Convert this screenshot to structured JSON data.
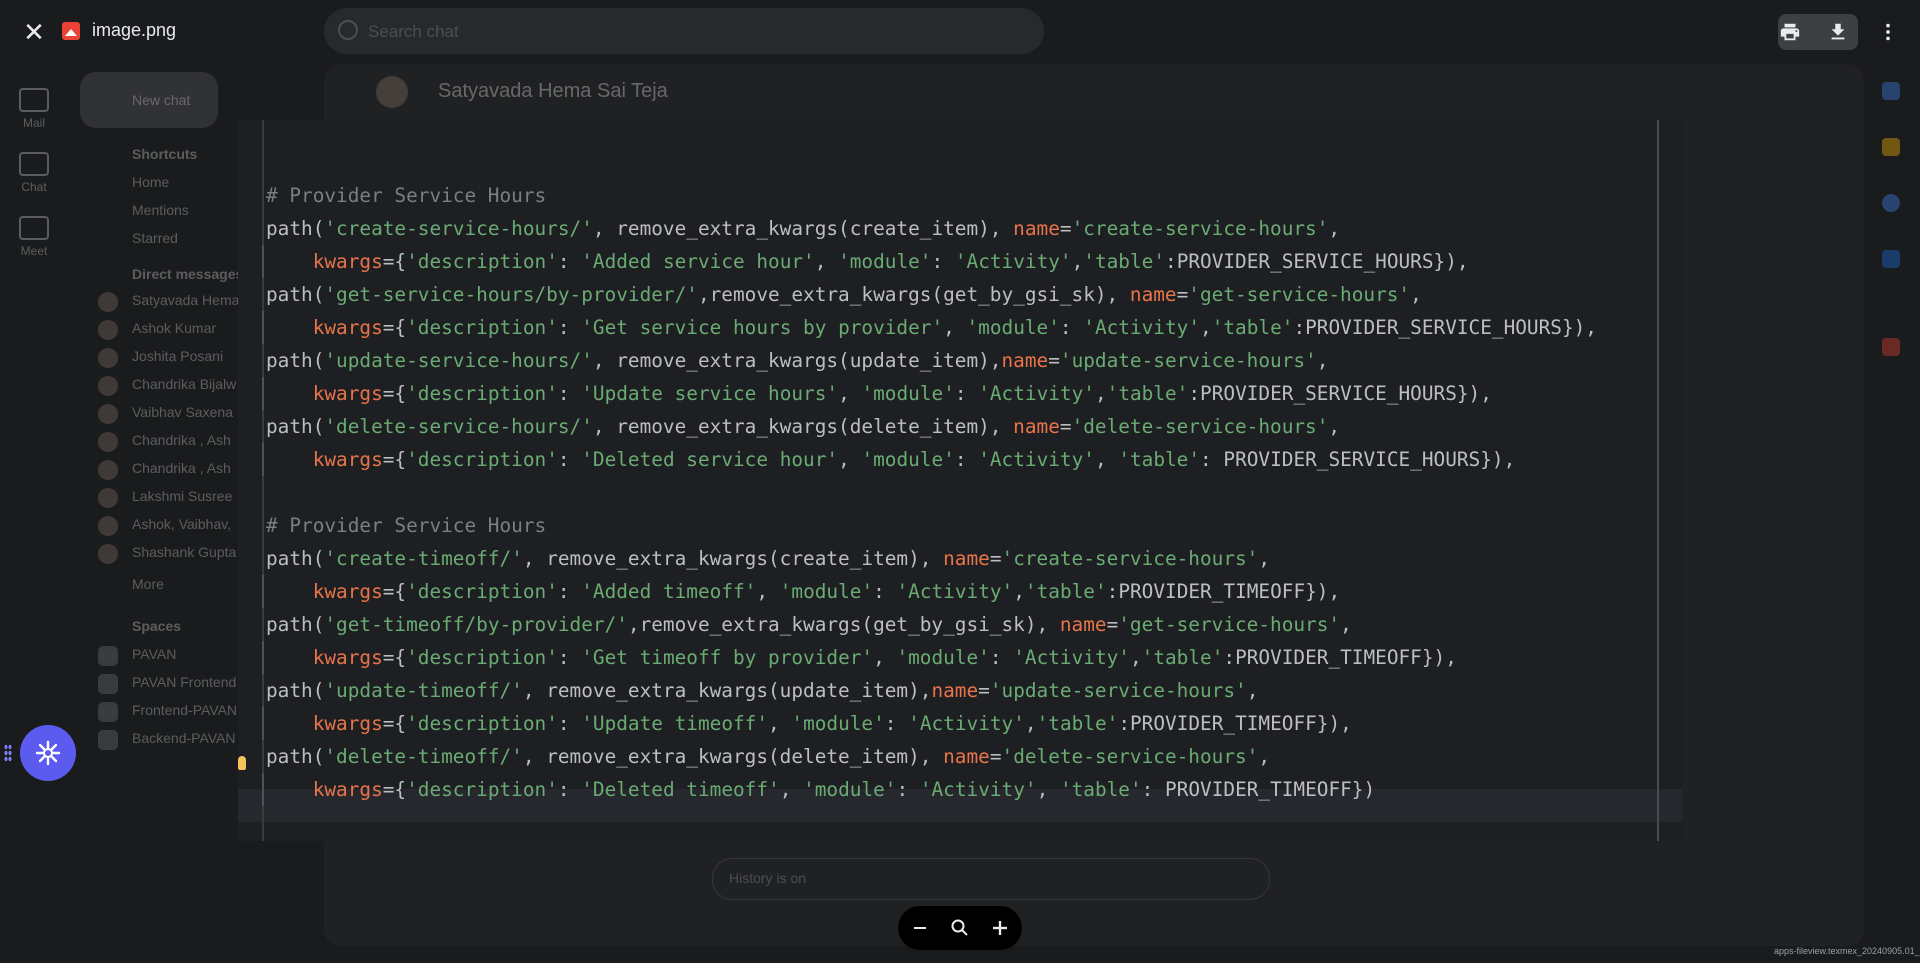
{
  "viewer": {
    "file_name": "image.png",
    "close_icon": "close-icon",
    "actions": [
      "print-icon",
      "download-icon",
      "more-vert-icon"
    ],
    "version_text": "apps-fileview.texmex_20240905.01_p1"
  },
  "background": {
    "search_placeholder": "Search chat",
    "rail": [
      "Mail",
      "Chat",
      "Meet"
    ],
    "new_chat": "New chat",
    "shortcuts_heading": "Shortcuts",
    "shortcuts": [
      "Home",
      "Mentions",
      "Starred"
    ],
    "dm_heading": "Direct messages",
    "dms": [
      "Satyavada Hema",
      "Ashok Kumar",
      "Joshita Posani",
      "Chandrika Bijalw",
      "Vaibhav Saxena",
      "Chandrika , Ash",
      "Chandrika , Ash",
      "Lakshmi Susree",
      "Ashok, Vaibhav,",
      "Shashank Gupta"
    ],
    "more": "More",
    "spaces_heading": "Spaces",
    "spaces": [
      "PAVAN",
      "PAVAN Frontend",
      "Frontend-PAVAN",
      "Backend-PAVAN"
    ],
    "chat_title": "Satyavada Hema Sai Teja",
    "composer_placeholder": "History is on"
  },
  "code_colors": {
    "default": "#bcbec4",
    "comment": "#7a7e85",
    "string": "#6aab73",
    "keyword_arg": "#e8744a"
  },
  "code": {
    "lines": [
      {
        "indent": false,
        "tokens": []
      },
      {
        "indent": false,
        "tokens": [
          [
            "c",
            "# Provider Service Hours"
          ]
        ]
      },
      {
        "indent": false,
        "tokens": [
          [
            "d",
            "path("
          ],
          [
            "s",
            "'create-service-hours/'"
          ],
          [
            "d",
            ", remove_extra_kwargs(create_item), "
          ],
          [
            "k",
            "name"
          ],
          [
            "d",
            "="
          ],
          [
            "s",
            "'create-service-hours'"
          ],
          [
            "d",
            ","
          ]
        ]
      },
      {
        "indent": true,
        "tokens": [
          [
            "d",
            "    "
          ],
          [
            "k",
            "kwargs"
          ],
          [
            "d",
            "={"
          ],
          [
            "s",
            "'description'"
          ],
          [
            "d",
            ": "
          ],
          [
            "s",
            "'Added service hour'"
          ],
          [
            "d",
            ", "
          ],
          [
            "s",
            "'module'"
          ],
          [
            "d",
            ": "
          ],
          [
            "s",
            "'Activity'"
          ],
          [
            "d",
            ","
          ],
          [
            "s",
            "'table'"
          ],
          [
            "d",
            ":PROVIDER_SERVICE_HOURS}),"
          ]
        ]
      },
      {
        "indent": false,
        "tokens": [
          [
            "d",
            "path("
          ],
          [
            "s",
            "'get-service-hours/by-provider/'"
          ],
          [
            "d",
            ",remove_extra_kwargs(get_by_gsi_sk), "
          ],
          [
            "k",
            "name"
          ],
          [
            "d",
            "="
          ],
          [
            "s",
            "'get-service-hours'"
          ],
          [
            "d",
            ","
          ]
        ]
      },
      {
        "indent": true,
        "tokens": [
          [
            "d",
            "    "
          ],
          [
            "k",
            "kwargs"
          ],
          [
            "d",
            "={"
          ],
          [
            "s",
            "'description'"
          ],
          [
            "d",
            ": "
          ],
          [
            "s",
            "'Get service hours by provider'"
          ],
          [
            "d",
            ", "
          ],
          [
            "s",
            "'module'"
          ],
          [
            "d",
            ": "
          ],
          [
            "s",
            "'Activity'"
          ],
          [
            "d",
            ","
          ],
          [
            "s",
            "'table'"
          ],
          [
            "d",
            ":PROVIDER_SERVICE_HOURS}),"
          ]
        ]
      },
      {
        "indent": false,
        "tokens": [
          [
            "d",
            "path("
          ],
          [
            "s",
            "'update-service-hours/'"
          ],
          [
            "d",
            ", remove_extra_kwargs(update_item),"
          ],
          [
            "k",
            "name"
          ],
          [
            "d",
            "="
          ],
          [
            "s",
            "'update-service-hours'"
          ],
          [
            "d",
            ","
          ]
        ]
      },
      {
        "indent": true,
        "tokens": [
          [
            "d",
            "    "
          ],
          [
            "k",
            "kwargs"
          ],
          [
            "d",
            "={"
          ],
          [
            "s",
            "'description'"
          ],
          [
            "d",
            ": "
          ],
          [
            "s",
            "'Update service hours'"
          ],
          [
            "d",
            ", "
          ],
          [
            "s",
            "'module'"
          ],
          [
            "d",
            ": "
          ],
          [
            "s",
            "'Activity'"
          ],
          [
            "d",
            ","
          ],
          [
            "s",
            "'table'"
          ],
          [
            "d",
            ":PROVIDER_SERVICE_HOURS}),"
          ]
        ]
      },
      {
        "indent": false,
        "tokens": [
          [
            "d",
            "path("
          ],
          [
            "s",
            "'delete-service-hours/'"
          ],
          [
            "d",
            ", remove_extra_kwargs(delete_item), "
          ],
          [
            "k",
            "name"
          ],
          [
            "d",
            "="
          ],
          [
            "s",
            "'delete-service-hours'"
          ],
          [
            "d",
            ","
          ]
        ]
      },
      {
        "indent": true,
        "tokens": [
          [
            "d",
            "    "
          ],
          [
            "k",
            "kwargs"
          ],
          [
            "d",
            "={"
          ],
          [
            "s",
            "'description'"
          ],
          [
            "d",
            ": "
          ],
          [
            "s",
            "'Deleted service hour'"
          ],
          [
            "d",
            ", "
          ],
          [
            "s",
            "'module'"
          ],
          [
            "d",
            ": "
          ],
          [
            "s",
            "'Activity'"
          ],
          [
            "d",
            ", "
          ],
          [
            "s",
            "'table'"
          ],
          [
            "d",
            ": PROVIDER_SERVICE_HOURS}),"
          ]
        ]
      },
      {
        "indent": false,
        "tokens": []
      },
      {
        "indent": false,
        "tokens": [
          [
            "c",
            "# Provider Service Hours"
          ]
        ]
      },
      {
        "indent": false,
        "tokens": [
          [
            "d",
            "path("
          ],
          [
            "s",
            "'create-timeoff/'"
          ],
          [
            "d",
            ", remove_extra_kwargs(create_item), "
          ],
          [
            "k",
            "name"
          ],
          [
            "d",
            "="
          ],
          [
            "s",
            "'create-service-hours'"
          ],
          [
            "d",
            ","
          ]
        ]
      },
      {
        "indent": true,
        "tokens": [
          [
            "d",
            "    "
          ],
          [
            "k",
            "kwargs"
          ],
          [
            "d",
            "={"
          ],
          [
            "s",
            "'description'"
          ],
          [
            "d",
            ": "
          ],
          [
            "s",
            "'Added timeoff'"
          ],
          [
            "d",
            ", "
          ],
          [
            "s",
            "'module'"
          ],
          [
            "d",
            ": "
          ],
          [
            "s",
            "'Activity'"
          ],
          [
            "d",
            ","
          ],
          [
            "s",
            "'table'"
          ],
          [
            "d",
            ":PROVIDER_TIMEOFF}),"
          ]
        ]
      },
      {
        "indent": false,
        "tokens": [
          [
            "d",
            "path("
          ],
          [
            "s",
            "'get-timeoff/by-provider/'"
          ],
          [
            "d",
            ",remove_extra_kwargs(get_by_gsi_sk), "
          ],
          [
            "k",
            "name"
          ],
          [
            "d",
            "="
          ],
          [
            "s",
            "'get-service-hours'"
          ],
          [
            "d",
            ","
          ]
        ]
      },
      {
        "indent": true,
        "tokens": [
          [
            "d",
            "    "
          ],
          [
            "k",
            "kwargs"
          ],
          [
            "d",
            "={"
          ],
          [
            "s",
            "'description'"
          ],
          [
            "d",
            ": "
          ],
          [
            "s",
            "'Get timeoff by provider'"
          ],
          [
            "d",
            ", "
          ],
          [
            "s",
            "'module'"
          ],
          [
            "d",
            ": "
          ],
          [
            "s",
            "'Activity'"
          ],
          [
            "d",
            ","
          ],
          [
            "s",
            "'table'"
          ],
          [
            "d",
            ":PROVIDER_TIMEOFF}),"
          ]
        ]
      },
      {
        "indent": false,
        "tokens": [
          [
            "d",
            "path("
          ],
          [
            "s",
            "'update-timeoff/'"
          ],
          [
            "d",
            ", remove_extra_kwargs(update_item),"
          ],
          [
            "k",
            "name"
          ],
          [
            "d",
            "="
          ],
          [
            "s",
            "'update-service-hours'"
          ],
          [
            "d",
            ","
          ]
        ]
      },
      {
        "indent": true,
        "tokens": [
          [
            "d",
            "    "
          ],
          [
            "k",
            "kwargs"
          ],
          [
            "d",
            "={"
          ],
          [
            "s",
            "'description'"
          ],
          [
            "d",
            ": "
          ],
          [
            "s",
            "'Update timeoff'"
          ],
          [
            "d",
            ", "
          ],
          [
            "s",
            "'module'"
          ],
          [
            "d",
            ": "
          ],
          [
            "s",
            "'Activity'"
          ],
          [
            "d",
            ","
          ],
          [
            "s",
            "'table'"
          ],
          [
            "d",
            ":PROVIDER_TIMEOFF}),"
          ]
        ]
      },
      {
        "indent": false,
        "tokens": [
          [
            "d",
            "path("
          ],
          [
            "s",
            "'delete-timeoff/'"
          ],
          [
            "d",
            ", remove_extra_kwargs(delete_item), "
          ],
          [
            "k",
            "name"
          ],
          [
            "d",
            "="
          ],
          [
            "s",
            "'delete-service-hours'"
          ],
          [
            "d",
            ","
          ]
        ]
      },
      {
        "indent": true,
        "tokens": [
          [
            "d",
            "    "
          ],
          [
            "k",
            "kwargs"
          ],
          [
            "d",
            "={"
          ],
          [
            "s",
            "'description'"
          ],
          [
            "d",
            ": "
          ],
          [
            "s",
            "'Deleted timeoff'"
          ],
          [
            "d",
            ", "
          ],
          [
            "s",
            "'module'"
          ],
          [
            "d",
            ": "
          ],
          [
            "s",
            "'Activity'"
          ],
          [
            "d",
            ", "
          ],
          [
            "s",
            "'table'"
          ],
          [
            "d",
            ": PROVIDER_TIMEOFF})"
          ]
        ]
      }
    ]
  },
  "zoom": {
    "out_icon": "zoom-out-icon",
    "reset_icon": "zoom-reset-icon",
    "in_icon": "zoom-in-icon"
  }
}
